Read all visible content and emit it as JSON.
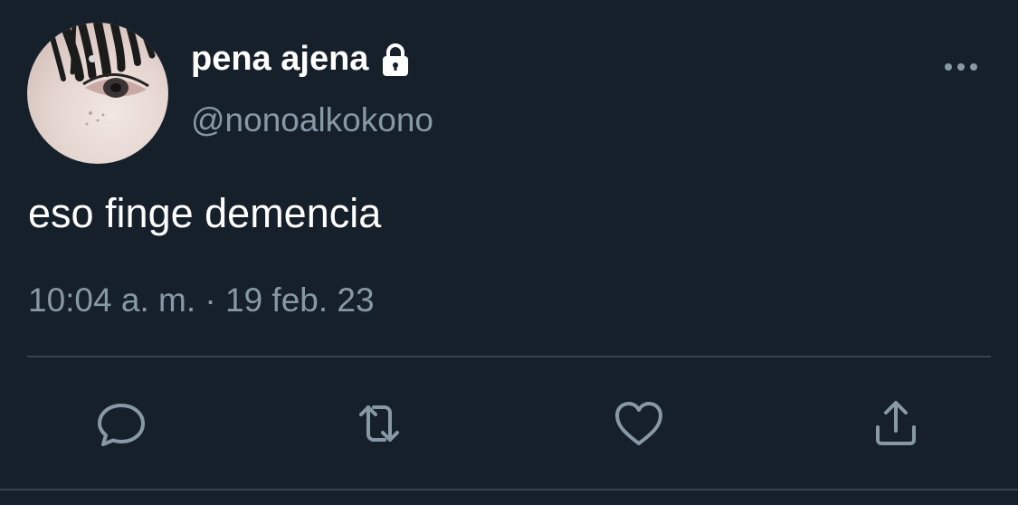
{
  "tweet": {
    "display_name": "pena ajena",
    "handle": "@nonoalkokono",
    "text": "eso finge demencia",
    "timestamp": "10:04 a. m. · 19 feb. 23",
    "protected_icon": "lock-icon"
  },
  "icons": {
    "more": "more-dots-icon",
    "reply": "reply-icon",
    "retweet": "retweet-icon",
    "like": "heart-icon",
    "share": "share-icon"
  },
  "colors": {
    "background": "#15202b",
    "primary_text": "#ffffff",
    "secondary_text": "#8899a6",
    "divider": "#38444d"
  }
}
